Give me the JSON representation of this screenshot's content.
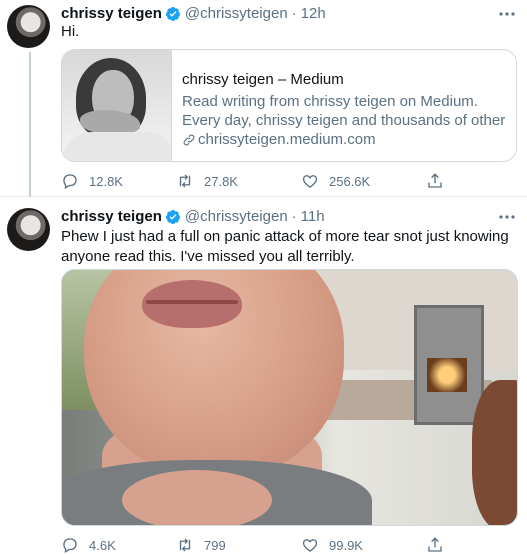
{
  "tweets": [
    {
      "name": "chrissy teigen",
      "handle": "@chrissyteigen",
      "separator": "·",
      "time": "12h",
      "text": "Hi.",
      "card": {
        "title": "chrissy teigen – Medium",
        "description": "Read writing from chrissy teigen on Medium. Every day, chrissy teigen and thousands of other voices rea...",
        "domain": "chrissyteigen.medium.com"
      },
      "counts": {
        "replies": "12.8K",
        "retweets": "27.8K",
        "likes": "256.6K"
      }
    },
    {
      "name": "chrissy teigen",
      "handle": "@chrissyteigen",
      "separator": "·",
      "time": "11h",
      "text": "Phew I just had a full on panic attack of more tear snot just knowing anyone read this. I've missed you all terribly.",
      "counts": {
        "replies": "4.6K",
        "retweets": "799",
        "likes": "99.9K"
      }
    }
  ],
  "colors": {
    "verified": "#1da1f2",
    "secondary_text": "#5b7083",
    "border": "#cfd9de"
  },
  "icons": [
    "verified-badge-icon",
    "more-icon",
    "link-icon",
    "reply-icon",
    "retweet-icon",
    "like-icon",
    "share-icon"
  ]
}
